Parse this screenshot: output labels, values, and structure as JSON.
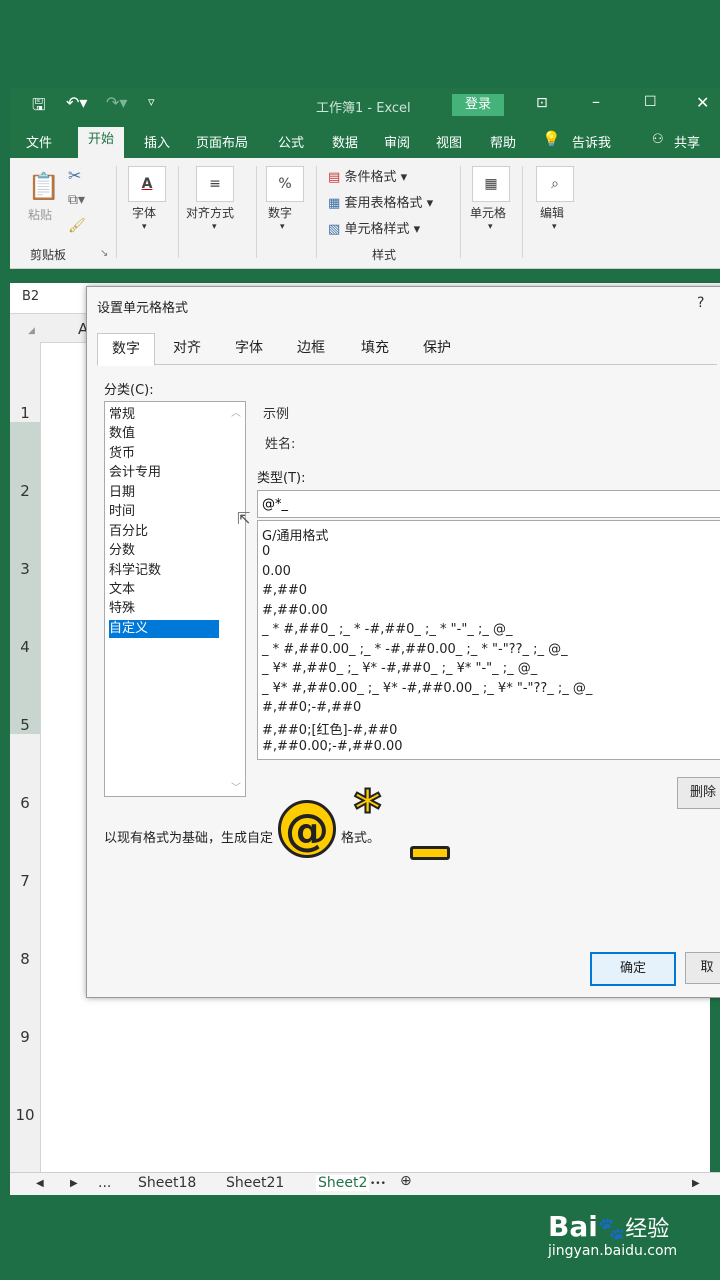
{
  "window": {
    "title": "工作簿1 - Excel",
    "login_label": "登录",
    "colors": {
      "excel_green": "#217346",
      "selection_blue": "#0078d7",
      "highlight_yellow": "#ffcc00"
    }
  },
  "ribbon_tabs": [
    {
      "label": "文件"
    },
    {
      "label": "开始"
    },
    {
      "label": "插入"
    },
    {
      "label": "页面布局"
    },
    {
      "label": "公式"
    },
    {
      "label": "数据"
    },
    {
      "label": "审阅"
    },
    {
      "label": "视图"
    },
    {
      "label": "帮助"
    },
    {
      "label": "告诉我"
    },
    {
      "label": "共享"
    }
  ],
  "ribbon": {
    "paste": "粘贴",
    "clipboard": "剪贴板",
    "font": "字体",
    "align": "对齐方式",
    "number": "数字",
    "cond_format": "条件格式",
    "table_format": "套用表格格式",
    "cell_style": "单元格样式",
    "styles": "样式",
    "cells": "单元格",
    "edit": "编辑"
  },
  "formula_bar": {
    "name_box": "B2",
    "col_a": "A"
  },
  "rows": [
    "1",
    "2",
    "3",
    "4",
    "5",
    "6",
    "7",
    "8",
    "9",
    "10"
  ],
  "sheets": {
    "nav_more": "...",
    "tab1": "Sheet18",
    "tab2": "Sheet21",
    "tab3": "Sheet2"
  },
  "dialog": {
    "title": "设置单元格格式",
    "help": "?",
    "tabs": [
      {
        "label": "数字"
      },
      {
        "label": "对齐"
      },
      {
        "label": "字体"
      },
      {
        "label": "边框"
      },
      {
        "label": "填充"
      },
      {
        "label": "保护"
      }
    ],
    "category_label": "分类(C):",
    "categories": [
      "常规",
      "数值",
      "货币",
      "会计专用",
      "日期",
      "时间",
      "百分比",
      "分数",
      "科学记数",
      "文本",
      "特殊",
      "自定义"
    ],
    "sample_label": "示例",
    "sample_value": "姓名:",
    "type_label": "类型(T):",
    "type_value": "@*_",
    "formats": [
      "G/通用格式",
      "0",
      "0.00",
      "#,##0",
      "#,##0.00",
      "_ * #,##0_ ;_ * -#,##0_ ;_ * \"-\"_ ;_ @_",
      "_ * #,##0.00_ ;_ * -#,##0.00_ ;_ * \"-\"??_ ;_ @_",
      "_ ¥* #,##0_ ;_ ¥* -#,##0_ ;_ ¥* \"-\"_ ;_ @_",
      "_ ¥* #,##0.00_ ;_ ¥* -#,##0.00_ ;_ ¥* \"-\"??_ ;_ @_",
      "#,##0;-#,##0",
      "#,##0;[红色]-#,##0",
      "#,##0.00;-#,##0.00"
    ],
    "delete_label": "删除",
    "hint_prefix": "以现有格式为基础，生成自定",
    "hint_suffix": "格式。",
    "ok_label": "确定",
    "cancel_label": "取"
  },
  "overlay": {
    "at": "@",
    "star": "*"
  },
  "watermark": {
    "brand": "Bai",
    "brand_cn": "经验",
    "url": "jingyan.baidu.com"
  }
}
